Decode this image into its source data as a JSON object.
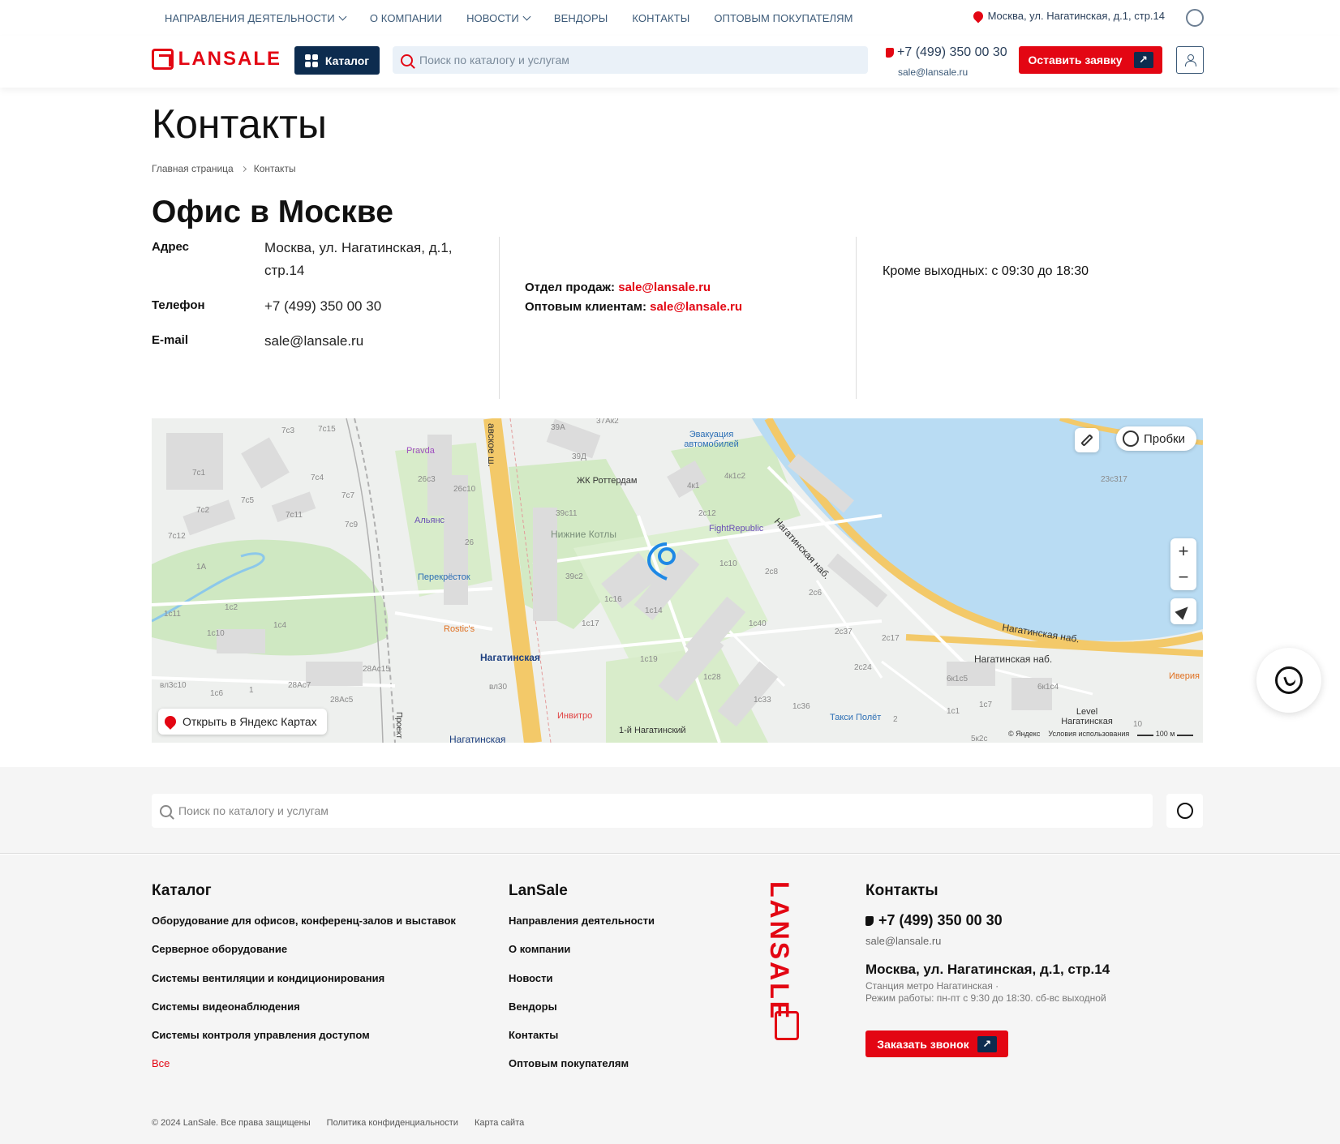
{
  "topnav": {
    "items": [
      {
        "label": "НАПРАВЛЕНИЯ ДЕЯТЕЛЬНОСТИ",
        "has_dropdown": true
      },
      {
        "label": "О КОМПАНИИ",
        "has_dropdown": false
      },
      {
        "label": "НОВОСТИ",
        "has_dropdown": true
      },
      {
        "label": "ВЕНДОРЫ",
        "has_dropdown": false
      },
      {
        "label": "КОНТАКТЫ",
        "has_dropdown": false
      },
      {
        "label": "ОПТОВЫМ ПОКУПАТЕЛЯМ",
        "has_dropdown": false
      }
    ],
    "address": "Москва, ул. Нагатинская, д.1, стр.14"
  },
  "header": {
    "logo_text": "LANSALE",
    "catalog_label": "Каталог",
    "search_placeholder": "Поиск по каталогу и услугам",
    "phone": "+7 (499) 350 00 30",
    "email": "sale@lansale.ru",
    "lead_button": "Оставить заявку",
    "arrow_glyph": "↗"
  },
  "page": {
    "title": "Контакты",
    "breadcrumb": [
      "Главная страница",
      "Контакты"
    ],
    "office_title": "Офис в Москве"
  },
  "info": {
    "address_label": "Адрес",
    "address_value": "Москва, ул. Нагатинская, д.1, стр.14",
    "phone_label": "Телефон",
    "phone_value": "+7 (499) 350 00 30",
    "email_label": "E-mail",
    "email_value": "sale@lansale.ru",
    "sales_label": "Отдел продаж: ",
    "sales_email": "sale@lansale.ru",
    "wholesale_label": "Оптовым клиентам: ",
    "wholesale_email": "sale@lansale.ru",
    "hours": "Кроме выходных: с 09:30 до 18:30"
  },
  "map": {
    "traffic_label": "Пробки",
    "open_label": "Открыть в Яндекс Картах",
    "copyright": "© Яндекс",
    "terms": "Условия использования",
    "scale": "100 м",
    "zoom_in": "+",
    "zoom_out": "−",
    "places": {
      "rotterdam": "ЖК Роттердам",
      "evac": "Эвакуация автомобилей",
      "fight": "FightRepublic",
      "kotly": "Нижние Котлы",
      "pravda": "Pravda",
      "alians": "Альянс",
      "perekrestok": "Перекрёсток",
      "rostics": "Rostic's",
      "nagatinskaya": "Нагатинская",
      "nagatinskaya2": "Нагатинская",
      "invitro": "Инвитро",
      "first_nag": "1-й Нагатинский",
      "taxi": "Такси Полёт",
      "level": "Level Нагатинская",
      "iveria": "Иверия",
      "embank1": "Нагатинская наб.",
      "embank2": "Нагатинская наб.",
      "embank3": "Нагатинская наб.",
      "highway": "авское ш.",
      "proekt": "Проект"
    },
    "buildings": [
      "7с3",
      "7с15",
      "7с1",
      "7с4",
      "7с5",
      "7с7",
      "7с2",
      "7с11",
      "7с9",
      "7с12",
      "1А",
      "1с11",
      "1с2",
      "1с4",
      "1с10",
      "1с6",
      "1",
      "28Ас15",
      "28Ас7",
      "28Ас5",
      "вл3с10",
      "26с3",
      "26с10",
      "26",
      "39А",
      "39Д",
      "39с11",
      "39с2",
      "1с16",
      "1с14",
      "1с17",
      "1с19",
      "1с28",
      "1с33",
      "1с36",
      "1с40",
      "1с10",
      "2с8",
      "2с6",
      "2с12",
      "2с37",
      "2с17",
      "2с24",
      "6к1с5",
      "6к1с4",
      "1с1",
      "1с7",
      "4к1с2",
      "4к1",
      "23с317",
      "вл30",
      "37Ак2",
      "2",
      "10",
      "5к2с"
    ]
  },
  "whatsapp_icon": "whatsapp-icon",
  "footer": {
    "search_placeholder": "Поиск по каталогу и услугам",
    "catalog_title": "Каталог",
    "catalog_items": [
      "Оборудование для офисов, конференц-залов и выставок",
      "Серверное оборудование",
      "Системы вентиляции и кондиционирования",
      "Системы видеонаблюдения",
      "Системы контроля управления доступом"
    ],
    "catalog_all": "Все",
    "lansale_title": "LanSale",
    "lansale_items": [
      "Направления деятельности",
      "О компании",
      "Новости",
      "Вендоры",
      "Контакты",
      "Оптовым покупателям"
    ],
    "logo_text": "LANSALE",
    "contacts_title": "Контакты",
    "phone": "+7 (499) 350 00 30",
    "email": "sale@lansale.ru",
    "address": "Москва, ул. Нагатинская, д.1, стр.14",
    "metro": "Станция метро Нагатинская ·",
    "schedule": "Режим работы: пн-пт с 9:30 до 18:30. сб-вс выходной",
    "callback": "Заказать звонок",
    "arrow_glyph": "↗",
    "copyright": "© 2024 LanSale. Все права защищены",
    "privacy": "Политика конфиденциальности",
    "sitemap": "Карта сайта"
  },
  "colors": {
    "brand_red": "#e30613",
    "navy": "#0d2c4f",
    "water": "#b9dcf3",
    "park": "#cfe8c2",
    "road": "#f3c969"
  }
}
